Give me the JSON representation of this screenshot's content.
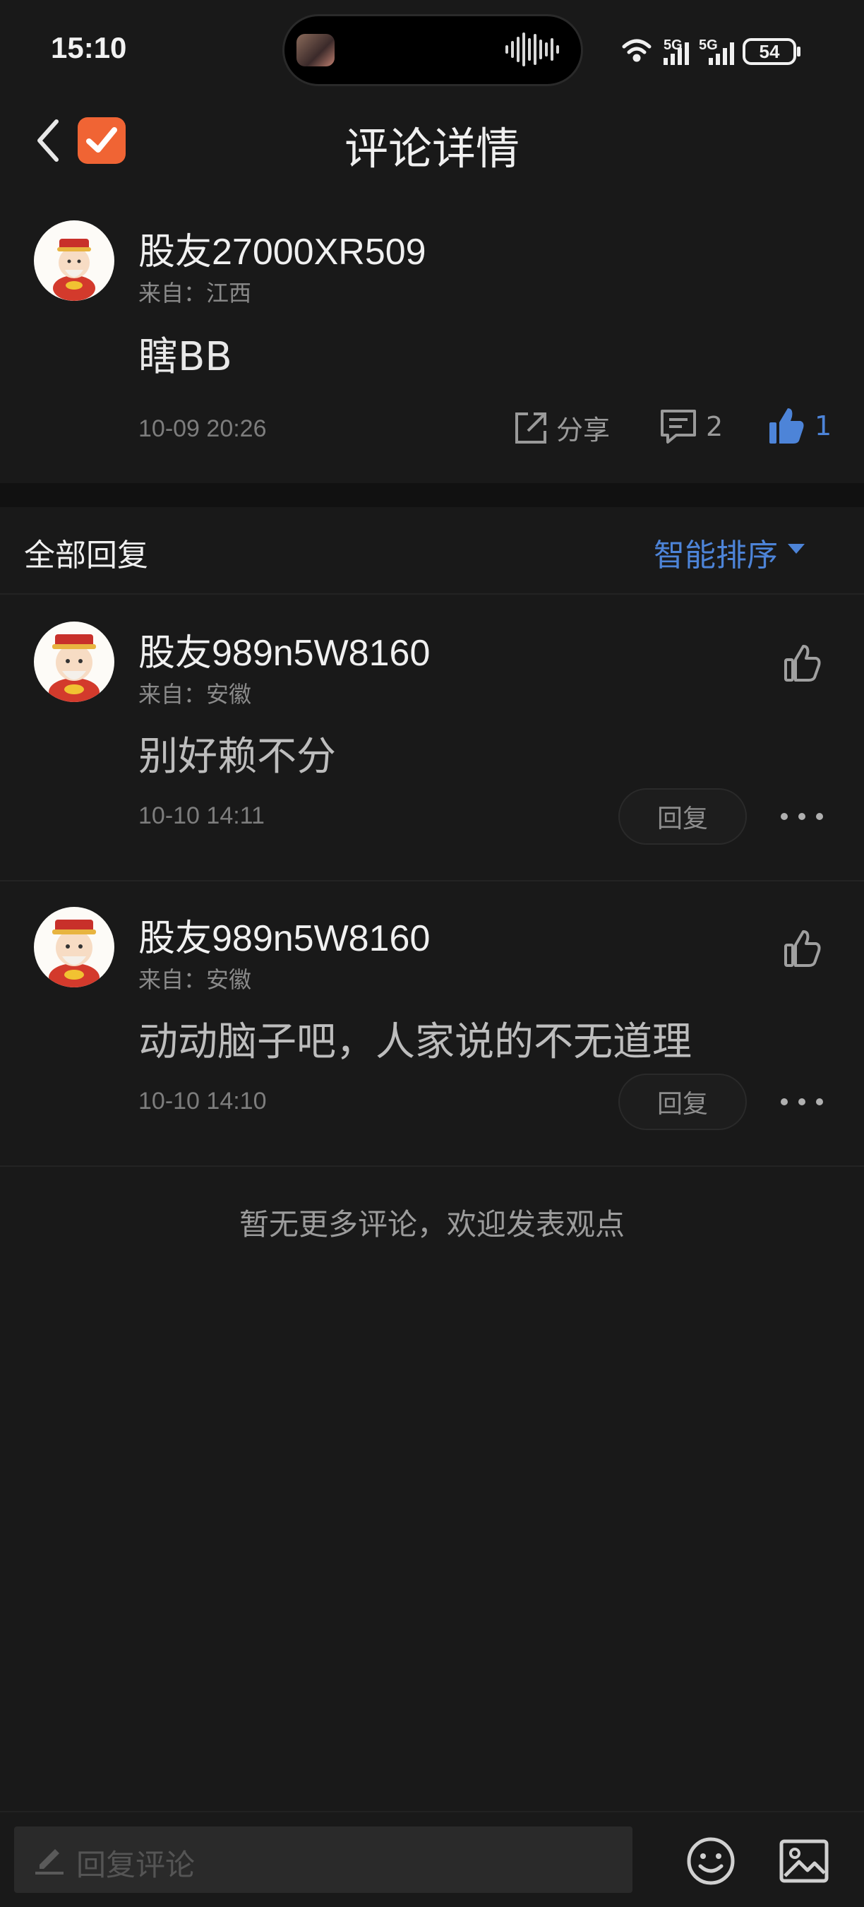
{
  "status": {
    "time": "15:10",
    "battery": "54",
    "net1": "5G",
    "net2": "5G"
  },
  "nav": {
    "title": "评论详情"
  },
  "main_comment": {
    "username": "股友27000XR509",
    "from": "来自：江西",
    "text": "瞎BB",
    "time": "10-09 20:26",
    "share_label": "分享",
    "reply_count": "2",
    "like_count": "1"
  },
  "replies_header": {
    "title": "全部回复",
    "sort": "智能排序"
  },
  "replies": [
    {
      "username": "股友989n5W8160",
      "from": "来自：安徽",
      "text": "别好赖不分",
      "time": "10-10 14:11",
      "reply_label": "回复"
    },
    {
      "username": "股友989n5W8160",
      "from": "来自：安徽",
      "text": "动动脑子吧，人家说的不无道理",
      "time": "10-10 14:10",
      "reply_label": "回复"
    }
  ],
  "end_note": "暂无更多评论，欢迎发表观点",
  "bottom": {
    "placeholder": "回复评论"
  },
  "colors": {
    "accent": "#4d84d8",
    "background": "#191919",
    "badge": "#f06434"
  }
}
